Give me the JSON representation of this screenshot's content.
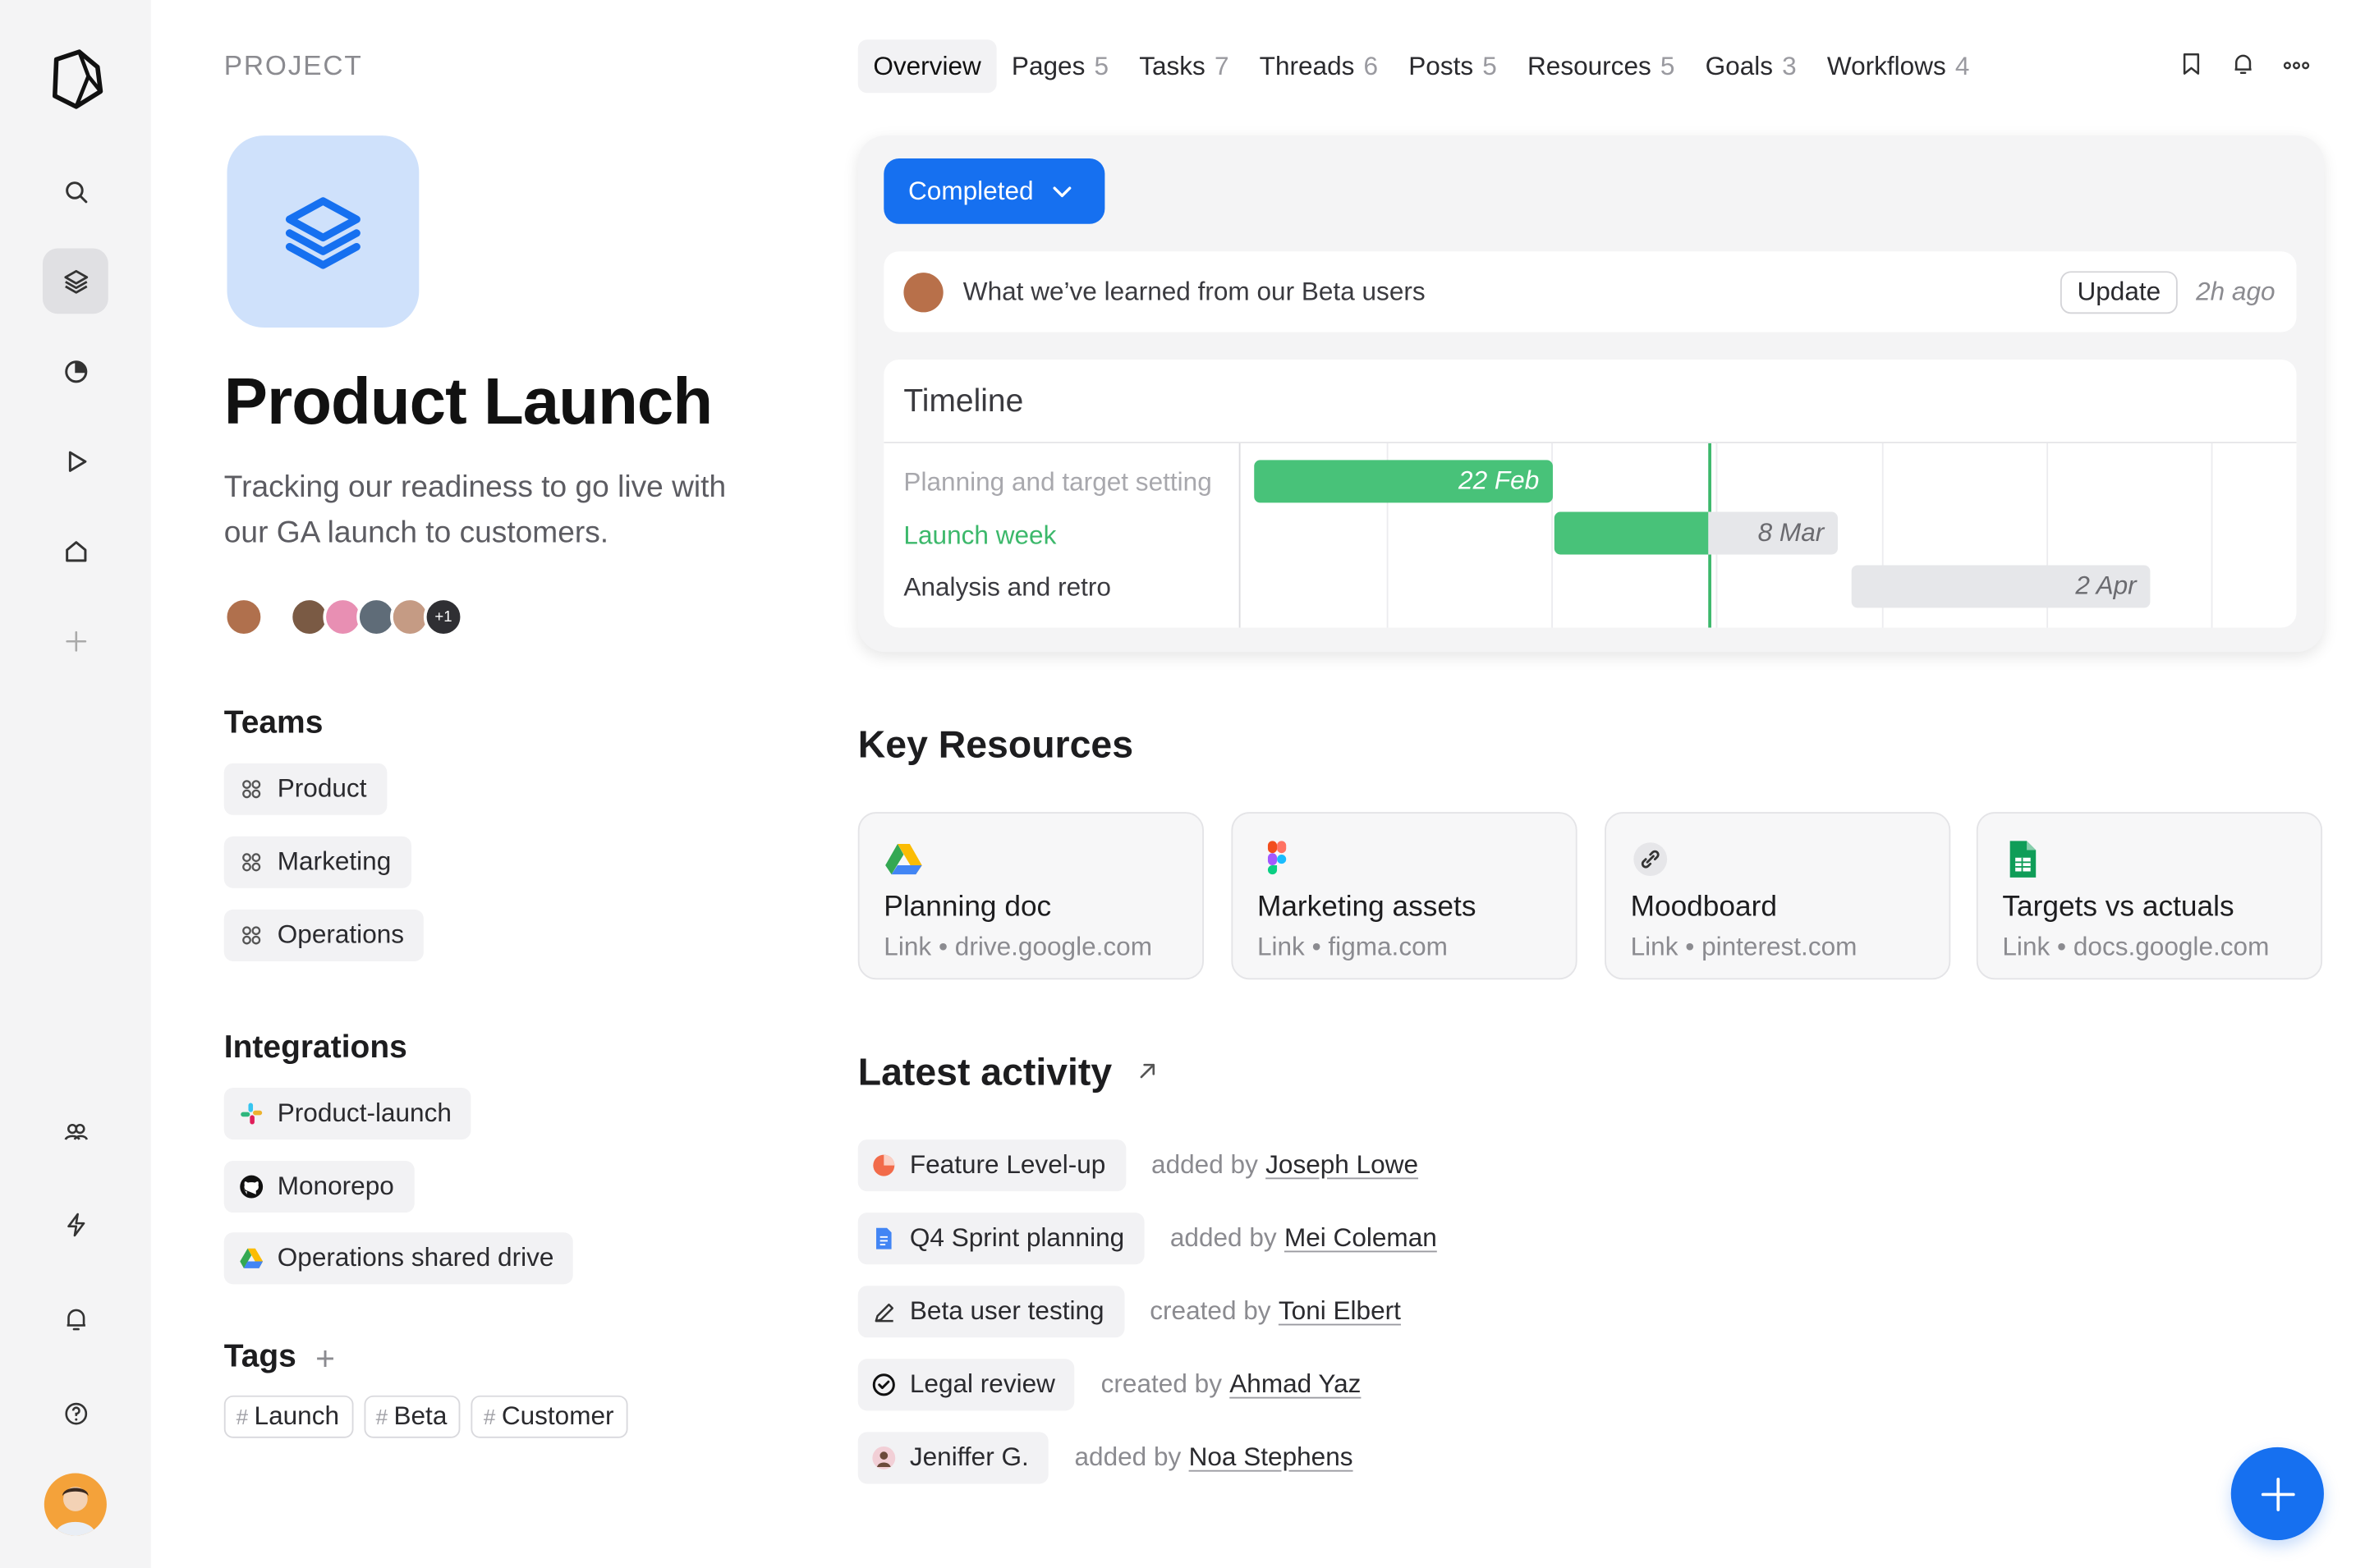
{
  "project": {
    "label": "PROJECT",
    "title": "Product Launch",
    "description": "Tracking our readiness to go live with our GA launch to customers.",
    "avatars_more": "+1"
  },
  "tabs": [
    {
      "label": "Overview",
      "count": ""
    },
    {
      "label": "Pages",
      "count": "5"
    },
    {
      "label": "Tasks",
      "count": "7"
    },
    {
      "label": "Threads",
      "count": "6"
    },
    {
      "label": "Posts",
      "count": "5"
    },
    {
      "label": "Resources",
      "count": "5"
    },
    {
      "label": "Goals",
      "count": "3"
    },
    {
      "label": "Workflows",
      "count": "4"
    }
  ],
  "teams": {
    "heading": "Teams",
    "items": [
      "Product",
      "Marketing",
      "Operations"
    ]
  },
  "integrations": {
    "heading": "Integrations",
    "items": [
      "Product-launch",
      "Monorepo",
      "Operations shared drive"
    ]
  },
  "tags": {
    "heading": "Tags",
    "items": [
      "Launch",
      "Beta",
      "Customer"
    ]
  },
  "status": {
    "label": "Completed",
    "update_text": "What we’ve learned from our Beta users",
    "update_button": "Update",
    "update_time": "2h ago"
  },
  "timeline": {
    "heading": "Timeline",
    "rows": [
      {
        "label": "Planning and target setting",
        "date": "22 Feb"
      },
      {
        "label": "Launch week",
        "date": "8 Mar"
      },
      {
        "label": "Analysis and retro",
        "date": "2 Apr"
      }
    ]
  },
  "key_resources": {
    "heading": "Key Resources",
    "items": [
      {
        "title": "Planning doc",
        "type": "Link",
        "domain": "drive.google.com",
        "icon": "google-drive-icon"
      },
      {
        "title": "Marketing assets",
        "type": "Link",
        "domain": "figma.com",
        "icon": "figma-icon"
      },
      {
        "title": "Moodboard",
        "type": "Link",
        "domain": "pinterest.com",
        "icon": "link-icon"
      },
      {
        "title": "Targets vs actuals",
        "type": "Link",
        "domain": "docs.google.com",
        "icon": "google-sheets-icon"
      }
    ]
  },
  "activity": {
    "heading": "Latest activity",
    "items": [
      {
        "title": "Feature Level-up",
        "verb": "added by",
        "person": "Joseph Lowe",
        "icon": "pie-icon"
      },
      {
        "title": "Q4 Sprint planning",
        "verb": "added by",
        "person": "Mei Coleman",
        "icon": "doc-icon"
      },
      {
        "title": "Beta user testing",
        "verb": "created by",
        "person": "Toni Elbert",
        "icon": "pencil-icon"
      },
      {
        "title": "Legal review",
        "verb": "created by",
        "person": "Ahmad Yaz",
        "icon": "check-circle-icon"
      },
      {
        "title": "Jeniffer G.",
        "verb": "added by",
        "person": "Noa Stephens",
        "icon": "person-avatar-icon"
      }
    ]
  },
  "colors": {
    "accent": "#1670f0",
    "success": "#48c279",
    "project_icon_bg": "#cfe1fb"
  }
}
